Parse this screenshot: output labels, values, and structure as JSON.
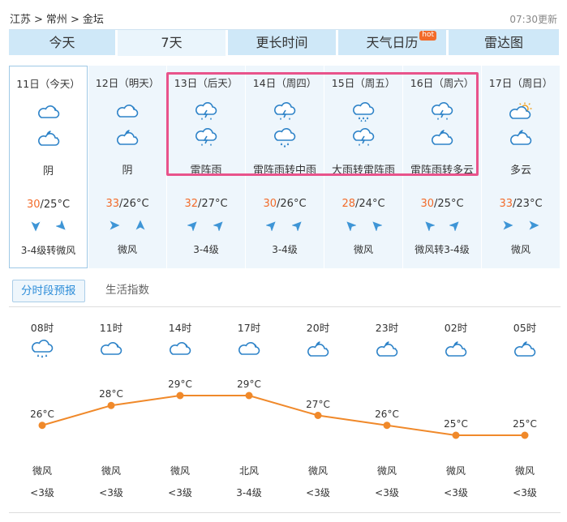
{
  "breadcrumb": {
    "province": "江苏",
    "city": "常州",
    "district": "金坛",
    "sep": ">"
  },
  "updated": "07:30更新",
  "tabs": [
    {
      "label": "今天"
    },
    {
      "label": "7天"
    },
    {
      "label": "更长时间"
    },
    {
      "label": "天气日历",
      "badge": "hot"
    },
    {
      "label": "雷达图"
    }
  ],
  "days": [
    {
      "date": "11日（今天）",
      "icon_top": "cloudy-icon",
      "icon_bottom": "cloudy-night-icon",
      "weather": "阴",
      "hi": "30",
      "lo": "/25°C",
      "wind_dirs": [
        "down",
        "down-right"
      ],
      "wind": "3-4级转微风"
    },
    {
      "date": "12日（明天）",
      "icon_top": "cloudy-icon",
      "icon_bottom": "cloudy-night-icon",
      "weather": "阴",
      "hi": "33",
      "lo": "/26°C",
      "wind_dirs": [
        "right",
        "up"
      ],
      "wind": "微风"
    },
    {
      "date": "13日（后天）",
      "icon_top": "thunder-shower-icon",
      "icon_bottom": "thunder-shower-icon",
      "weather": "雷阵雨",
      "hi": "32",
      "lo": "/27°C",
      "wind_dirs": [
        "up-right",
        "up-right"
      ],
      "wind": "3-4级"
    },
    {
      "date": "14日（周四）",
      "icon_top": "thunder-shower-icon",
      "icon_bottom": "moderate-rain-icon",
      "weather": "雷阵雨转中雨",
      "hi": "30",
      "lo": "/26°C",
      "wind_dirs": [
        "up-right",
        "up-right"
      ],
      "wind": "3-4级"
    },
    {
      "date": "15日（周五）",
      "icon_top": "heavy-rain-icon",
      "icon_bottom": "thunder-shower-icon",
      "weather": "大雨转雷阵雨",
      "hi": "28",
      "lo": "/24°C",
      "wind_dirs": [
        "up-left",
        "up-left"
      ],
      "wind": "微风"
    },
    {
      "date": "16日（周六）",
      "icon_top": "thunder-shower-icon",
      "icon_bottom": "cloudy-night-icon",
      "weather": "雷阵雨转多云",
      "hi": "30",
      "lo": "/25°C",
      "wind_dirs": [
        "up-left",
        "up-right"
      ],
      "wind": "微风转3-4级"
    },
    {
      "date": "17日（周日）",
      "icon_top": "sun-cloud-icon",
      "icon_bottom": "cloudy-night-icon",
      "weather": "多云",
      "hi": "33",
      "lo": "/23°C",
      "wind_dirs": [
        "right",
        "right"
      ],
      "wind": "微风"
    }
  ],
  "subtabs": [
    {
      "label": "分时段预报"
    },
    {
      "label": "生活指数"
    }
  ],
  "hourly": [
    {
      "time": "08时",
      "icon": "rain-shower-icon",
      "temp_label": "26°C",
      "temp": 26,
      "wind": "微风",
      "level": "<3级"
    },
    {
      "time": "11时",
      "icon": "cloudy-icon",
      "temp_label": "28°C",
      "temp": 28,
      "wind": "微风",
      "level": "<3级"
    },
    {
      "time": "14时",
      "icon": "cloudy-icon",
      "temp_label": "29°C",
      "temp": 29,
      "wind": "微风",
      "level": "<3级"
    },
    {
      "time": "17时",
      "icon": "cloudy-icon",
      "temp_label": "29°C",
      "temp": 29,
      "wind": "北风",
      "level": "3-4级"
    },
    {
      "time": "20时",
      "icon": "cloudy-night-icon",
      "temp_label": "27°C",
      "temp": 27,
      "wind": "微风",
      "level": "<3级"
    },
    {
      "time": "23时",
      "icon": "cloudy-night-icon",
      "temp_label": "26°C",
      "temp": 26,
      "wind": "微风",
      "level": "<3级"
    },
    {
      "time": "02时",
      "icon": "cloudy-night-icon",
      "temp_label": "25°C",
      "temp": 25,
      "wind": "微风",
      "level": "<3级"
    },
    {
      "time": "05时",
      "icon": "cloudy-night-icon",
      "temp_label": "25°C",
      "temp": 25,
      "wind": "微风",
      "level": "<3级"
    }
  ],
  "colors": {
    "accent": "#2f8ed9",
    "hot_temp": "#f26b2a",
    "curve": "#f0892a",
    "highlight": "#e8538b",
    "icon": "#2e83c8"
  }
}
